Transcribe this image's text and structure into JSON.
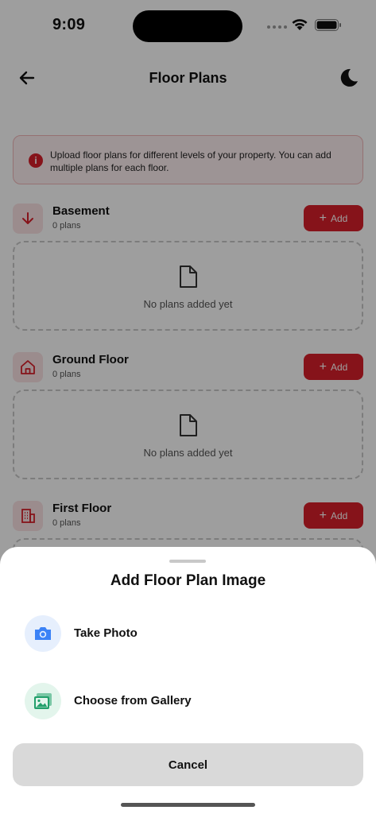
{
  "status_bar": {
    "time": "9:09"
  },
  "header": {
    "title": "Floor Plans"
  },
  "info_banner": {
    "text": "Upload floor plans for different levels of your property. You can add multiple plans for each floor."
  },
  "floors": [
    {
      "name": "Basement",
      "count": "0 plans",
      "add_label": "Add",
      "empty_text": "No plans added yet",
      "icon": "arrow-down-icon"
    },
    {
      "name": "Ground Floor",
      "count": "0 plans",
      "add_label": "Add",
      "empty_text": "No plans added yet",
      "icon": "home-icon"
    },
    {
      "name": "First Floor",
      "count": "0 plans",
      "add_label": "Add",
      "icon": "building-icon"
    }
  ],
  "sheet": {
    "title": "Add Floor Plan Image",
    "options": [
      {
        "label": "Take Photo",
        "icon": "camera-icon",
        "color": "#3b82f6"
      },
      {
        "label": "Choose from Gallery",
        "icon": "gallery-icon",
        "color": "#22a06b"
      }
    ],
    "cancel_label": "Cancel"
  },
  "colors": {
    "accent": "#d8202a",
    "accent_soft": "#fbe3e4",
    "overlay": "rgba(0,0,0,0.38)"
  }
}
